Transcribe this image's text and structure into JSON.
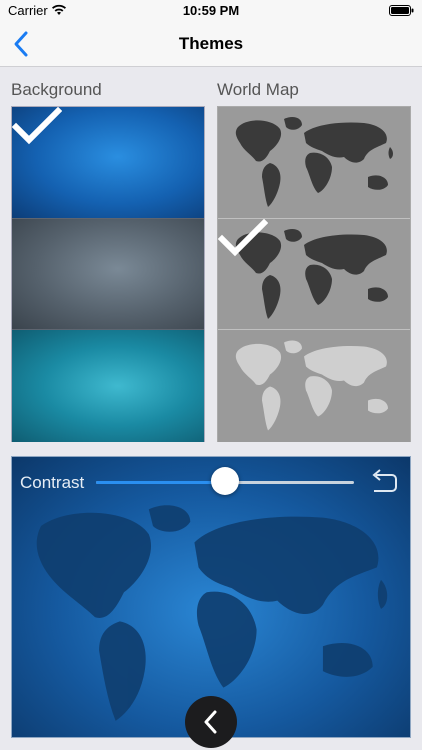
{
  "status_bar": {
    "carrier": "Carrier",
    "time": "10:59 PM"
  },
  "nav": {
    "title": "Themes",
    "back_icon": "chevron-left-icon"
  },
  "sections": {
    "background_label": "Background",
    "world_map_label": "World Map"
  },
  "backgrounds": [
    {
      "name": "blue",
      "selected": true
    },
    {
      "name": "slate",
      "selected": false
    },
    {
      "name": "teal",
      "selected": false
    }
  ],
  "world_maps": [
    {
      "name": "dark-on-gray",
      "selected": false
    },
    {
      "name": "dark-selected",
      "selected": true
    },
    {
      "name": "light-on-gray",
      "selected": false
    }
  ],
  "preview": {
    "contrast_label": "Contrast",
    "contrast_value": 0.5
  },
  "colors": {
    "accent": "#2a8ff0",
    "nav_tint": "#1a7cf3"
  }
}
